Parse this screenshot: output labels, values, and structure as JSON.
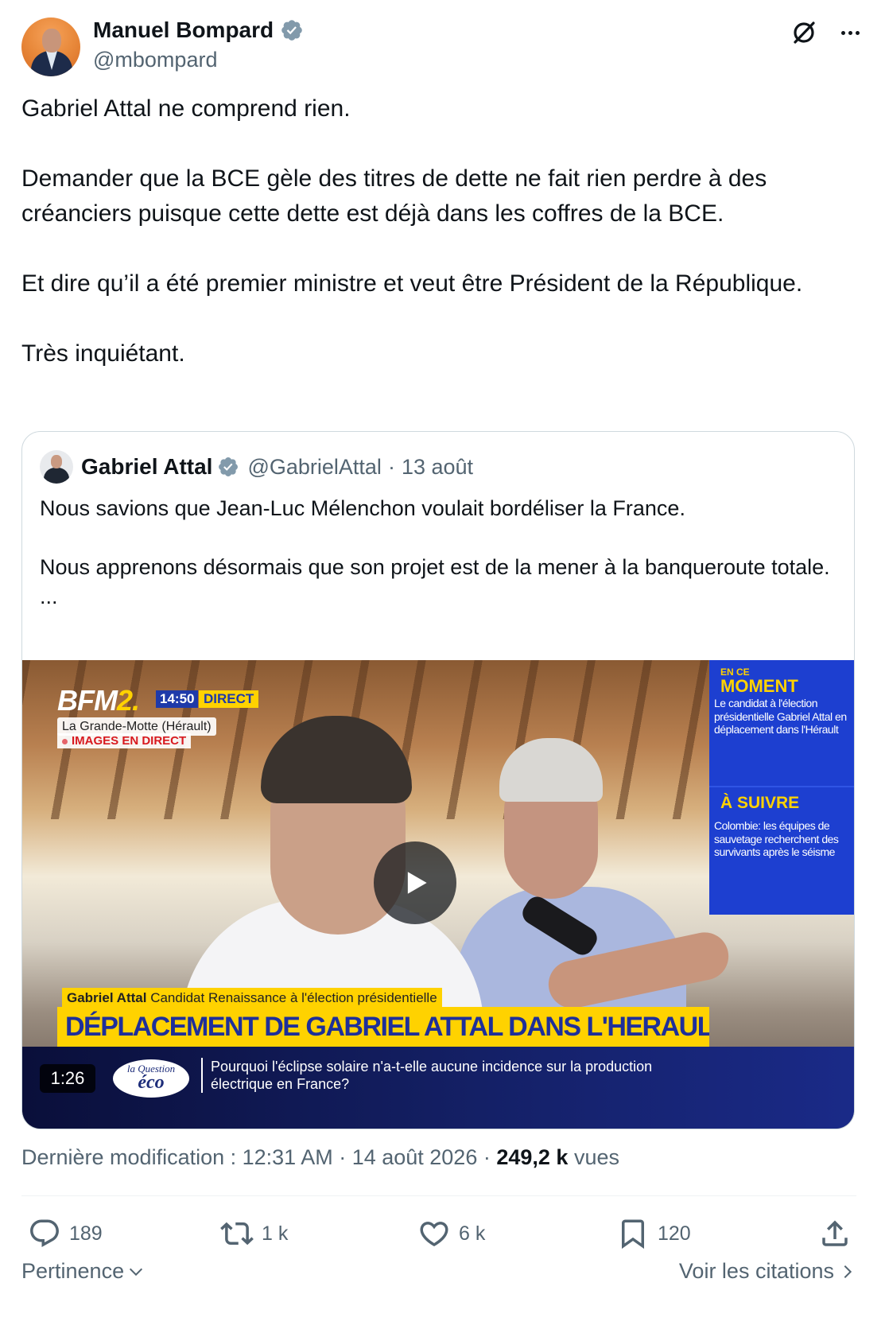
{
  "tweet": {
    "author_name": "Manuel Bompard",
    "author_handle": "@mbompard",
    "paragraphs": [
      "Gabriel Attal ne comprend rien.",
      "Demander que la BCE gèle des titres de dette ne fait rien perdre à des créanciers puisque cette dette est déjà dans les coffres de la BCE.",
      "Et dire qu’il a été premier ministre et veut être Président de la République.",
      "Très inquiétant."
    ]
  },
  "quote": {
    "author_name": "Gabriel Attal",
    "author_handle": "@GabrielAttal",
    "separator": "·",
    "date": "13 août",
    "paragraphs": [
      "Nous savions que Jean-Luc Mélenchon voulait bordéliser la France.",
      "Nous apprenons désormais que son projet est de la mener à la banqueroute totale.\n..."
    ],
    "video": {
      "duration": "1:26",
      "channel_logo": "BFM",
      "channel_logo_suffix": "2.",
      "time": "14:50",
      "live_label": "DIRECT",
      "location": "La Grande-Motte (Hérault)",
      "live_images": "IMAGES EN DIRECT",
      "panel": {
        "now_small": "EN CE",
        "now_title": "MOMENT",
        "now_text": "Le candidat à l'élection présidentielle Gabriel Attal en déplacement dans l'Hérault",
        "next_title": "À SUIVRE",
        "next_text": "Colombie: les équipes de sauvetage recherchent des survivants après le séisme"
      },
      "lower_name": "Gabriel Attal",
      "lower_role": "Candidat Renaissance à l'élection présidentielle",
      "headline": "DÉPLACEMENT DE GABRIEL ATTAL DANS L'HERAULT",
      "show_logo_top": "la Question",
      "show_logo_main": "éco",
      "ticker": "Pourquoi l'éclipse solaire n'a-t-elle aucune incidence sur la production électrique en France?"
    }
  },
  "meta": {
    "edited_prefix": "Dernière modification : 12:31 AM · 14 août 2026 · ",
    "views_count": "249,2 k",
    "views_label": " vues"
  },
  "actions": {
    "replies": "189",
    "reposts": "1 k",
    "likes": "6 k",
    "bookmarks": "120"
  },
  "footer": {
    "sort_label": "Pertinence",
    "quotes_link": "Voir les citations"
  },
  "colors": {
    "text": "#0f1419",
    "secondary": "#536471",
    "verified": "#829aab",
    "border": "#cfd9de"
  }
}
